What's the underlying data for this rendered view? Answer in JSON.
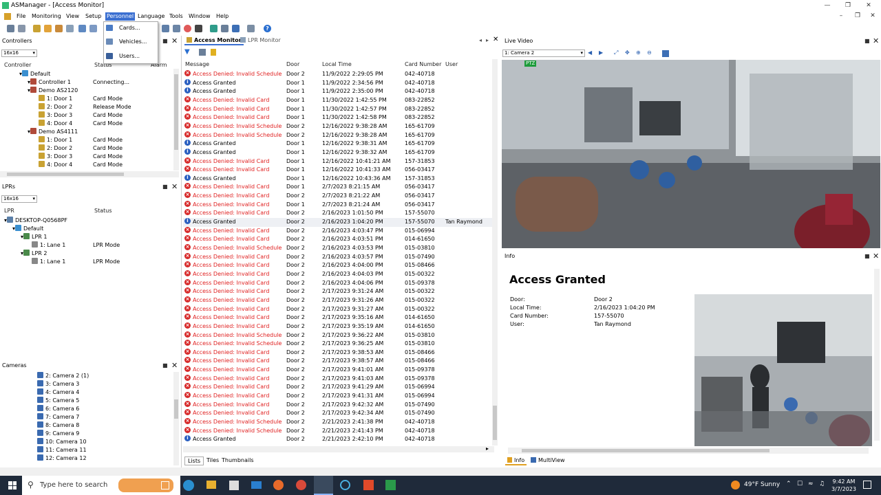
{
  "window": {
    "title": "ASManager - [Access Monitor]"
  },
  "menu": [
    "File",
    "Monitoring",
    "View",
    "Setup",
    "Personnel",
    "Language",
    "Tools",
    "Window",
    "Help"
  ],
  "personnel_menu": [
    "Cards...",
    "Vehicles...",
    "Users..."
  ],
  "controllers_panel": {
    "title": "Controllers",
    "select": "16x16",
    "columns": [
      "Controller",
      "Status",
      "Alarm"
    ],
    "rows": [
      {
        "label": "Default",
        "status": "",
        "indent": 1
      },
      {
        "label": "Controller 1",
        "status": "Connecting...",
        "indent": 2
      },
      {
        "label": "Demo AS2120",
        "status": "",
        "indent": 2
      },
      {
        "label": "1: Door 1",
        "status": "Card Mode",
        "indent": 3
      },
      {
        "label": "2: Door 2",
        "status": "Release Mode",
        "indent": 3
      },
      {
        "label": "3: Door 3",
        "status": "Card Mode",
        "indent": 3
      },
      {
        "label": "4: Door 4",
        "status": "Card Mode",
        "indent": 3
      },
      {
        "label": "Demo AS4111",
        "status": "",
        "indent": 2
      },
      {
        "label": "1: Door 1",
        "status": "Card Mode",
        "indent": 3
      },
      {
        "label": "2: Door 2",
        "status": "Card Mode",
        "indent": 3
      },
      {
        "label": "3: Door 3",
        "status": "Card Mode",
        "indent": 3
      },
      {
        "label": "4: Door 4",
        "status": "Card Mode",
        "indent": 3
      }
    ]
  },
  "lprs_panel": {
    "title": "LPRs",
    "select": "16x16",
    "columns": [
      "LPR",
      "Status"
    ],
    "rows": [
      {
        "label": "DESKTOP-Q0568PF",
        "status": "",
        "indent": 0
      },
      {
        "label": "Default",
        "status": "",
        "indent": 1
      },
      {
        "label": "LPR 1",
        "status": "",
        "indent": 2
      },
      {
        "label": "1: Lane 1",
        "status": "LPR Mode",
        "indent": 3
      },
      {
        "label": "LPR 2",
        "status": "",
        "indent": 2
      },
      {
        "label": "1: Lane 1",
        "status": "LPR Mode",
        "indent": 3
      }
    ]
  },
  "cameras_panel": {
    "title": "Cameras",
    "items": [
      "2: Camera 2 (1)",
      "3: Camera 3",
      "4: Camera 4",
      "5: Camera 5",
      "6: Camera 6",
      "7: Camera 7",
      "8: Camera 8",
      "9: Camera 9",
      "10: Camera 10",
      "11: Camera 11",
      "12: Camera 12"
    ]
  },
  "monitor": {
    "tabs": [
      "Access Monitor",
      "LPR Monitor"
    ],
    "columns": [
      "Message",
      "Door",
      "Local Time",
      "Card Number",
      "User"
    ],
    "rows": [
      [
        "e",
        "Access Denied: Invalid Schedule",
        "Door 2",
        "11/9/2022 2:29:05 PM",
        "042-40718",
        ""
      ],
      [
        "i",
        "Access Granted",
        "Door 1",
        "11/9/2022 2:34:56 PM",
        "042-40718",
        ""
      ],
      [
        "i",
        "Access Granted",
        "Door 1",
        "11/9/2022 2:35:00 PM",
        "042-40718",
        ""
      ],
      [
        "e",
        "Access Denied: Invalid Card",
        "Door 1",
        "11/30/2022 1:42:55 PM",
        "083-22852",
        ""
      ],
      [
        "e",
        "Access Denied: Invalid Card",
        "Door 1",
        "11/30/2022 1:42:57 PM",
        "083-22852",
        ""
      ],
      [
        "e",
        "Access Denied: Invalid Card",
        "Door 1",
        "11/30/2022 1:42:58 PM",
        "083-22852",
        ""
      ],
      [
        "e",
        "Access Denied: Invalid Schedule",
        "Door 2",
        "12/16/2022 9:38:28 AM",
        "165-61709",
        ""
      ],
      [
        "e",
        "Access Denied: Invalid Schedule",
        "Door 2",
        "12/16/2022 9:38:28 AM",
        "165-61709",
        ""
      ],
      [
        "i",
        "Access Granted",
        "Door 1",
        "12/16/2022 9:38:31 AM",
        "165-61709",
        ""
      ],
      [
        "i",
        "Access Granted",
        "Door 1",
        "12/16/2022 9:38:32 AM",
        "165-61709",
        ""
      ],
      [
        "e",
        "Access Denied: Invalid Card",
        "Door 1",
        "12/16/2022 10:41:21 AM",
        "157-31853",
        ""
      ],
      [
        "e",
        "Access Denied: Invalid Card",
        "Door 1",
        "12/16/2022 10:41:33 AM",
        "056-03417",
        ""
      ],
      [
        "i",
        "Access Granted",
        "Door 1",
        "12/16/2022 10:43:36 AM",
        "157-31853",
        ""
      ],
      [
        "e",
        "Access Denied: Invalid Card",
        "Door 1",
        "2/7/2023 8:21:15 AM",
        "056-03417",
        ""
      ],
      [
        "e",
        "Access Denied: Invalid Card",
        "Door 2",
        "2/7/2023 8:21:22 AM",
        "056-03417",
        ""
      ],
      [
        "e",
        "Access Denied: Invalid Card",
        "Door 1",
        "2/7/2023 8:21:24 AM",
        "056-03417",
        ""
      ],
      [
        "e",
        "Access Denied: Invalid Card",
        "Door 2",
        "2/16/2023 1:01:50 PM",
        "157-55070",
        ""
      ],
      [
        "i",
        "Access Granted",
        "Door 2",
        "2/16/2023 1:04:20 PM",
        "157-55070",
        "Tan Raymond"
      ],
      [
        "e",
        "Access Denied: Invalid Card",
        "Door 2",
        "2/16/2023 4:03:47 PM",
        "015-06994",
        ""
      ],
      [
        "e",
        "Access Denied: Invalid Card",
        "Door 2",
        "2/16/2023 4:03:51 PM",
        "014-61650",
        ""
      ],
      [
        "e",
        "Access Denied: Invalid Schedule",
        "Door 2",
        "2/16/2023 4:03:53 PM",
        "015-03810",
        ""
      ],
      [
        "e",
        "Access Denied: Invalid Card",
        "Door 2",
        "2/16/2023 4:03:57 PM",
        "015-07490",
        ""
      ],
      [
        "e",
        "Access Denied: Invalid Card",
        "Door 2",
        "2/16/2023 4:04:00 PM",
        "015-08466",
        ""
      ],
      [
        "e",
        "Access Denied: Invalid Card",
        "Door 2",
        "2/16/2023 4:04:03 PM",
        "015-00322",
        ""
      ],
      [
        "e",
        "Access Denied: Invalid Card",
        "Door 2",
        "2/16/2023 4:04:06 PM",
        "015-09378",
        ""
      ],
      [
        "e",
        "Access Denied: Invalid Card",
        "Door 2",
        "2/17/2023 9:31:24 AM",
        "015-00322",
        ""
      ],
      [
        "e",
        "Access Denied: Invalid Card",
        "Door 2",
        "2/17/2023 9:31:26 AM",
        "015-00322",
        ""
      ],
      [
        "e",
        "Access Denied: Invalid Card",
        "Door 2",
        "2/17/2023 9:31:27 AM",
        "015-00322",
        ""
      ],
      [
        "e",
        "Access Denied: Invalid Card",
        "Door 2",
        "2/17/2023 9:35:16 AM",
        "014-61650",
        ""
      ],
      [
        "e",
        "Access Denied: Invalid Card",
        "Door 2",
        "2/17/2023 9:35:19 AM",
        "014-61650",
        ""
      ],
      [
        "e",
        "Access Denied: Invalid Schedule",
        "Door 2",
        "2/17/2023 9:36:22 AM",
        "015-03810",
        ""
      ],
      [
        "e",
        "Access Denied: Invalid Schedule",
        "Door 2",
        "2/17/2023 9:36:25 AM",
        "015-03810",
        ""
      ],
      [
        "e",
        "Access Denied: Invalid Card",
        "Door 2",
        "2/17/2023 9:38:53 AM",
        "015-08466",
        ""
      ],
      [
        "e",
        "Access Denied: Invalid Card",
        "Door 2",
        "2/17/2023 9:38:57 AM",
        "015-08466",
        ""
      ],
      [
        "e",
        "Access Denied: Invalid Card",
        "Door 2",
        "2/17/2023 9:41:01 AM",
        "015-09378",
        ""
      ],
      [
        "e",
        "Access Denied: Invalid Card",
        "Door 2",
        "2/17/2023 9:41:03 AM",
        "015-09378",
        ""
      ],
      [
        "e",
        "Access Denied: Invalid Card",
        "Door 2",
        "2/17/2023 9:41:29 AM",
        "015-06994",
        ""
      ],
      [
        "e",
        "Access Denied: Invalid Card",
        "Door 2",
        "2/17/2023 9:41:31 AM",
        "015-06994",
        ""
      ],
      [
        "e",
        "Access Denied: Invalid Card",
        "Door 2",
        "2/17/2023 9:42:32 AM",
        "015-07490",
        ""
      ],
      [
        "e",
        "Access Denied: Invalid Card",
        "Door 2",
        "2/17/2023 9:42:34 AM",
        "015-07490",
        ""
      ],
      [
        "e",
        "Access Denied: Invalid Schedule",
        "Door 2",
        "2/21/2023 2:41:38 PM",
        "042-40718",
        ""
      ],
      [
        "e",
        "Access Denied: Invalid Schedule",
        "Door 2",
        "2/21/2023 2:41:43 PM",
        "042-40718",
        ""
      ],
      [
        "i",
        "Access Granted",
        "Door 2",
        "2/21/2023 2:42:10 PM",
        "042-40718",
        ""
      ]
    ],
    "bottom_tabs": [
      "Lists",
      "Tiles",
      "Thumbnails"
    ]
  },
  "live_video": {
    "title": "Live Video",
    "camera_select": "1: Camera 2",
    "ptz_label": "PTZ"
  },
  "info": {
    "title": "Info",
    "heading": "Access Granted",
    "fields": [
      {
        "label": "Door:",
        "value": "Door 2"
      },
      {
        "label": "Local Time:",
        "value": "2/16/2023 1:04:20 PM"
      },
      {
        "label": "Card Number:",
        "value": "157-55070"
      },
      {
        "label": "User:",
        "value": "Tan Raymond"
      }
    ],
    "tabs": [
      "Info",
      "MultiView"
    ]
  },
  "taskbar": {
    "search_placeholder": "Type here to search",
    "weather": "49°F  Sunny",
    "time": "9:42 AM",
    "date": "3/7/2023"
  }
}
